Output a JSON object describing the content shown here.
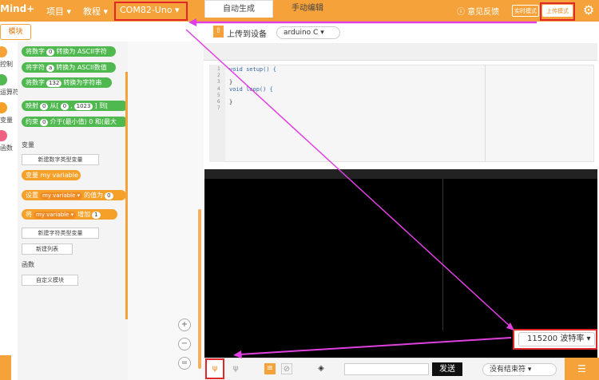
{
  "topbar": {
    "logo": "Mind+",
    "menu_project": "项目 ▾",
    "menu_tutorial": "教程 ▾",
    "port": "COM82-Uno ▾",
    "feedback": "ⓘ 意见反馈",
    "realtime_mode": "实时模式",
    "upload_mode": "上传模式"
  },
  "sidebar": {
    "module_tab": "模块",
    "categories": [
      "控制",
      "运算符",
      "变量",
      "函数"
    ]
  },
  "blocks": {
    "b1": {
      "pre": "将数字",
      "val": "0",
      "post": "转换为 ASCII字符"
    },
    "b2": {
      "pre": "将字符",
      "val": "a",
      "post": "转换为 ASCII数值"
    },
    "b3": {
      "pre": "将数字",
      "val": "132",
      "post": "转换为字符串"
    },
    "b4": {
      "pre": "映射",
      "val1": "0",
      "mid1": "从[",
      "val2": "0",
      "mid2": ",",
      "val3": "1023",
      "post": "] 到["
    },
    "b5": {
      "pre": "约束",
      "val": "0",
      "post": "介于(最小值) 0 和(最大"
    },
    "var_section": "变量",
    "new_num_var": "新建数字类型变量",
    "var_block": "变量 my variable",
    "set_block": {
      "pre": "设置",
      "var": "my variable ▾",
      "mid": "的值为",
      "val": "0"
    },
    "change_block": {
      "pre": "将",
      "var": "my variable ▾",
      "mid": "增加",
      "val": "1"
    },
    "new_str_var": "新建字符类型变量",
    "new_list": "新建列表",
    "func_section": "函数",
    "custom_module": "自定义模块"
  },
  "zoom": {
    "in": "+",
    "out": "−",
    "reset": "="
  },
  "upload_bar": {
    "label": "上传到设备",
    "board": "arduino C ▾"
  },
  "tabs": [
    "自动生成",
    "手动编辑"
  ],
  "code": {
    "line_numbers": [
      "1",
      "2",
      "3",
      "4",
      "5",
      "6",
      "7"
    ],
    "lines": [
      "void setup() {",
      "",
      "}",
      "void loop() {",
      "",
      "}",
      ""
    ]
  },
  "serial": {
    "baud": "115200 波特率 ▾",
    "send": "发送",
    "ending": "没有结束符 ▾"
  },
  "colors": {
    "accent": "#f6a23a",
    "highlight": "#e0282a",
    "arrow": "#e040e0"
  }
}
